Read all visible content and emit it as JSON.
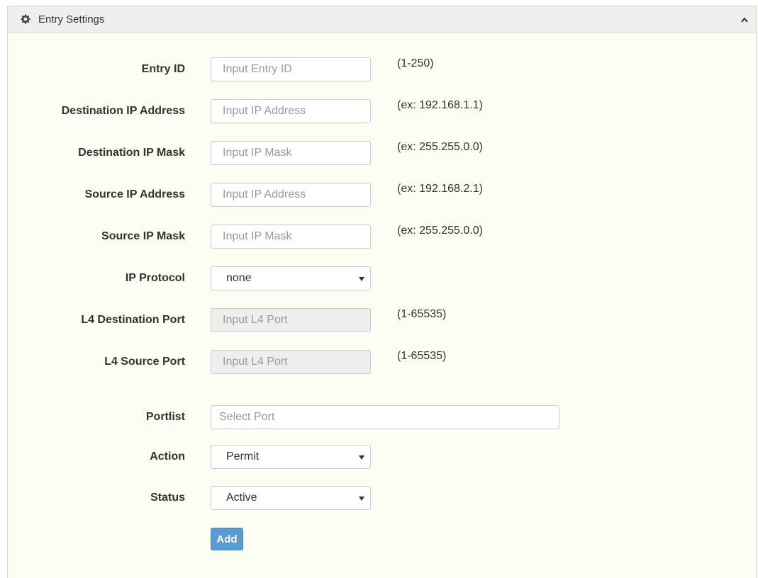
{
  "panel": {
    "title": "Entry Settings",
    "icon": "gear-icon",
    "collapse_icon": "chevron-up-icon"
  },
  "form": {
    "entry_id": {
      "label": "Entry ID",
      "placeholder": "Input Entry ID",
      "hint": "(1-250)"
    },
    "dest_ip": {
      "label": "Destination IP Address",
      "placeholder": "Input IP Address",
      "hint": "(ex: 192.168.1.1)"
    },
    "dest_mask": {
      "label": "Destination IP Mask",
      "placeholder": "Input IP Mask",
      "hint": "(ex: 255.255.0.0)"
    },
    "src_ip": {
      "label": "Source IP Address",
      "placeholder": "Input IP Address",
      "hint": "(ex: 192.168.2.1)"
    },
    "src_mask": {
      "label": "Source IP Mask",
      "placeholder": "Input IP Mask",
      "hint": "(ex: 255.255.0.0)"
    },
    "ip_protocol": {
      "label": "IP Protocol",
      "value": "none"
    },
    "l4_dest_port": {
      "label": "L4 Destination Port",
      "placeholder": "Input L4 Port",
      "hint": "(1-65535)"
    },
    "l4_src_port": {
      "label": "L4 Source Port",
      "placeholder": "Input L4 Port",
      "hint": "(1-65535)"
    },
    "portlist": {
      "label": "Portlist",
      "placeholder": "Select Port"
    },
    "action": {
      "label": "Action",
      "value": "Permit"
    },
    "status": {
      "label": "Status",
      "value": "Active"
    },
    "add_label": "Add"
  },
  "colors": {
    "panel_bg": "#fcfdf3",
    "header_bg": "#efefef",
    "button_bg": "#5b9bd4",
    "disabled_bg": "#eeeeee"
  }
}
